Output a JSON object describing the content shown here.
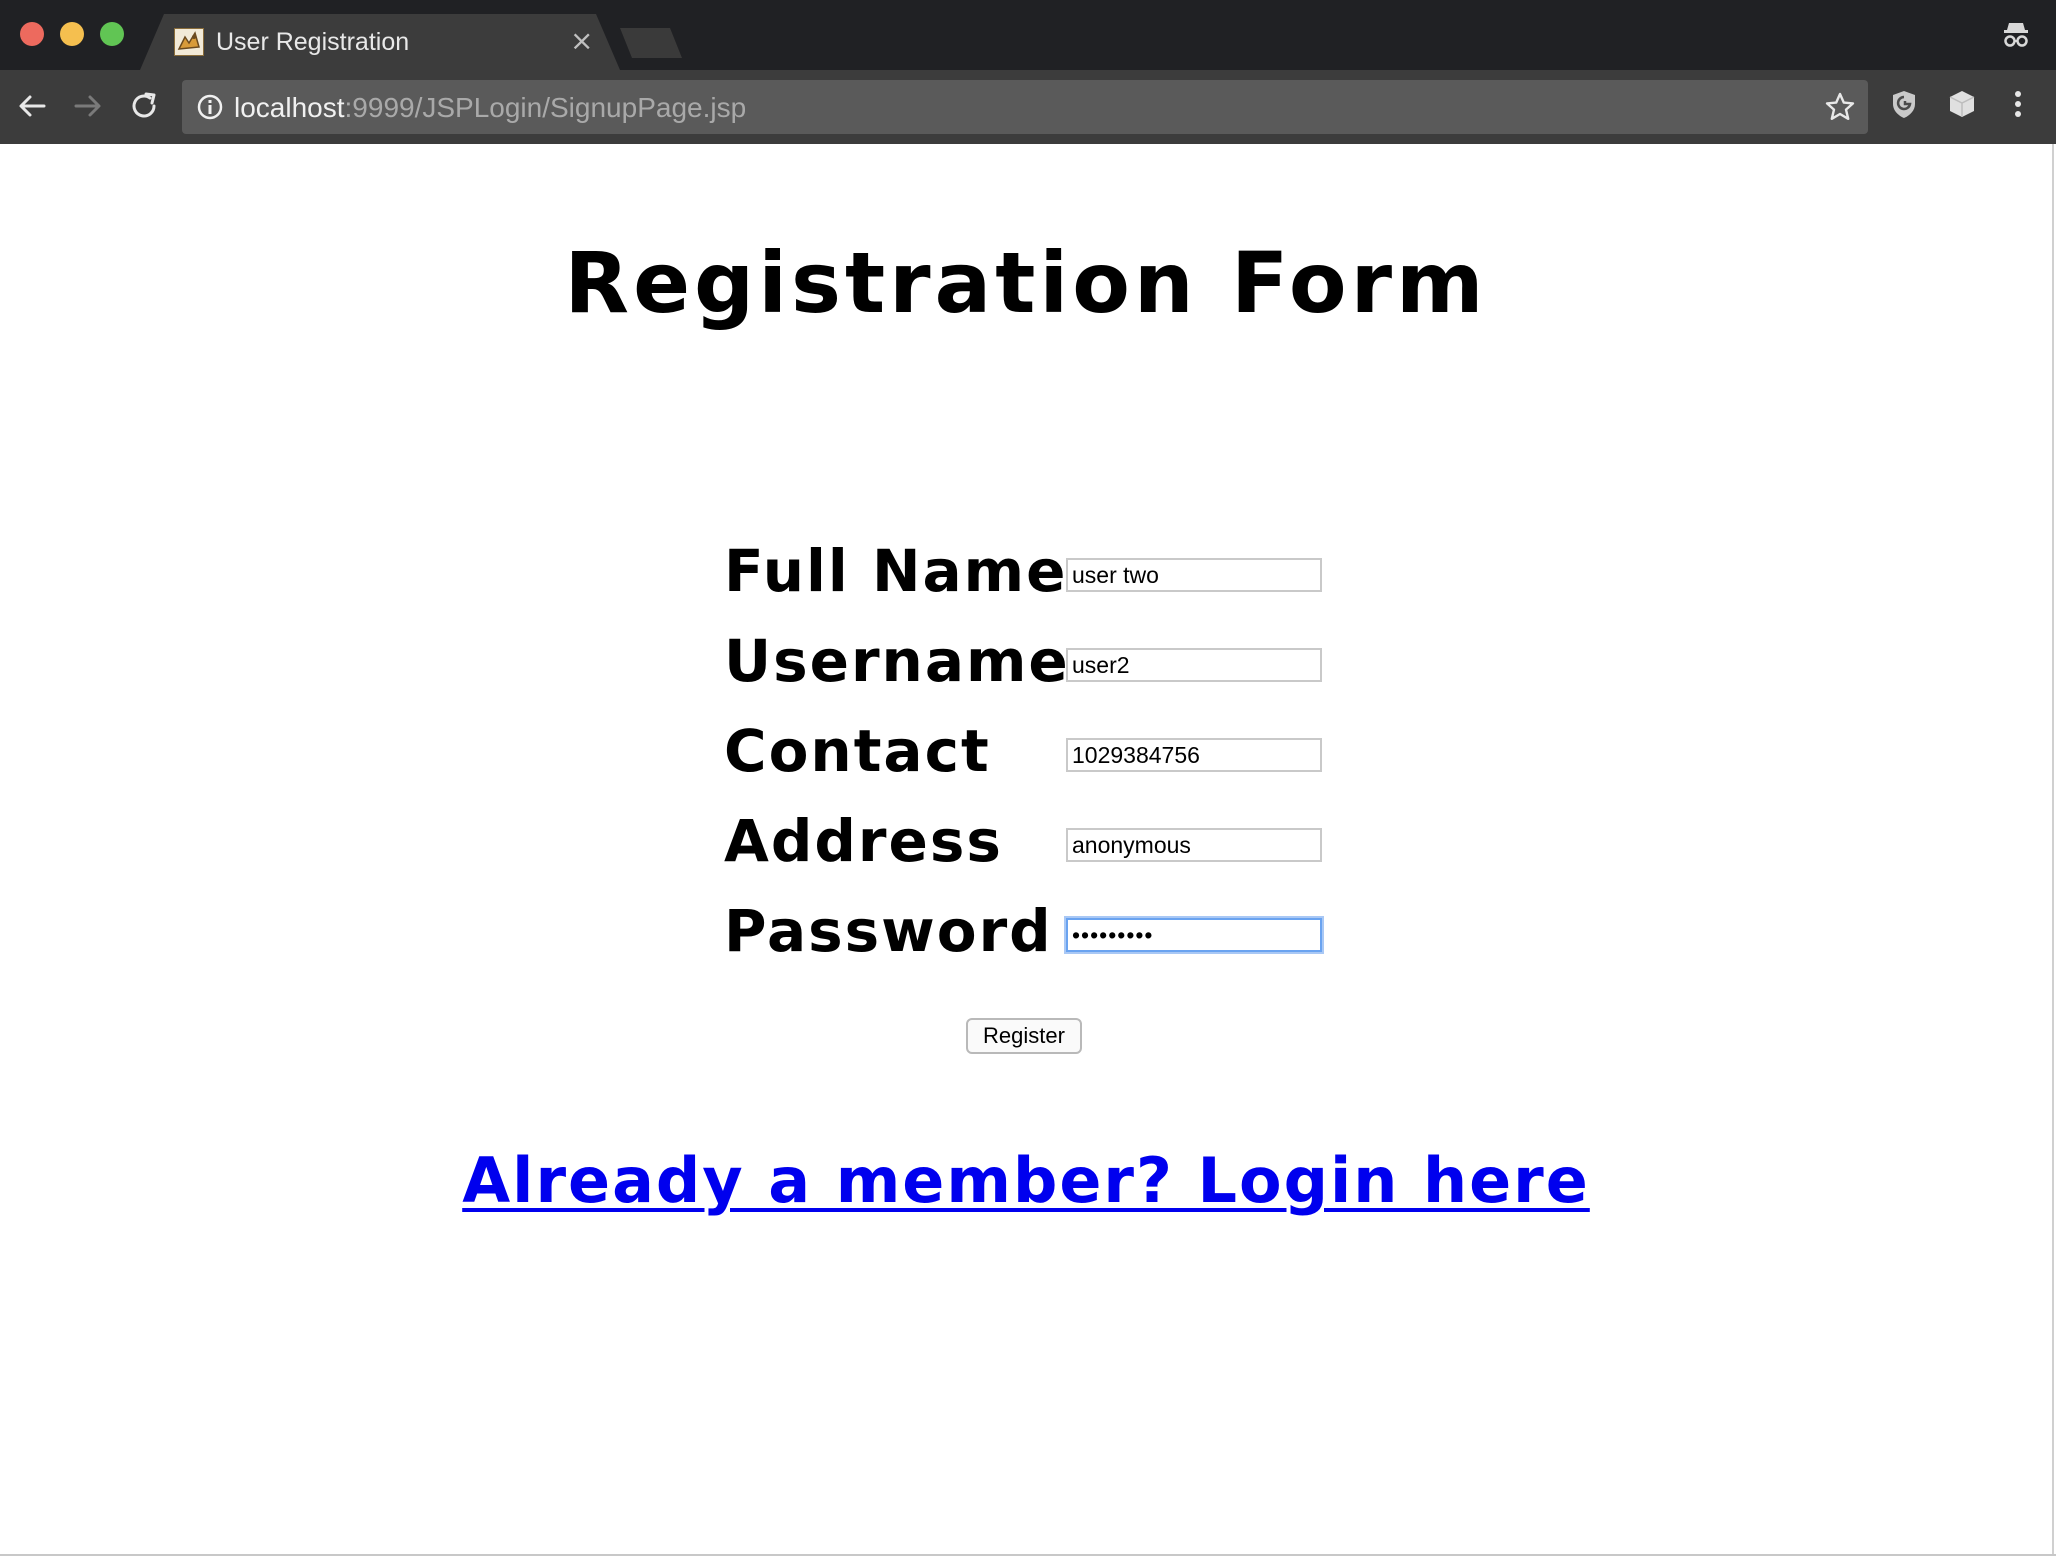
{
  "browser": {
    "tab_title": "User Registration",
    "tab_close": "×",
    "url_host": "localhost",
    "url_path": ":9999/JSPLogin/SignupPage.jsp",
    "icons": {
      "favicon": "tomcat-favicon",
      "close": "close-icon",
      "incognito": "incognito-icon",
      "back": "back-arrow-icon",
      "forward": "forward-arrow-icon",
      "reload": "reload-icon",
      "info": "info-icon",
      "star": "star-icon",
      "extension1": "shield-extension-icon",
      "extension2": "cube-extension-icon",
      "menu": "kebab-menu-icon"
    },
    "colors": {
      "tabstrip": "#202124",
      "toolbar": "#3c3c3c",
      "omnibox": "#5a5a5a"
    }
  },
  "page": {
    "heading": "Registration Form",
    "fields": [
      {
        "label": "Full Name",
        "value": "user two"
      },
      {
        "label": "Username",
        "value": "user2"
      },
      {
        "label": "Contact",
        "value": "1029384756"
      },
      {
        "label": "Address",
        "value": "anonymous"
      },
      {
        "label": "Password",
        "value": "•••••••••"
      }
    ],
    "register_label": "Register",
    "login_link": "Already a member? Login here",
    "colors": {
      "link": "#0000ee",
      "focus_ring": "#6aa3f0"
    }
  }
}
